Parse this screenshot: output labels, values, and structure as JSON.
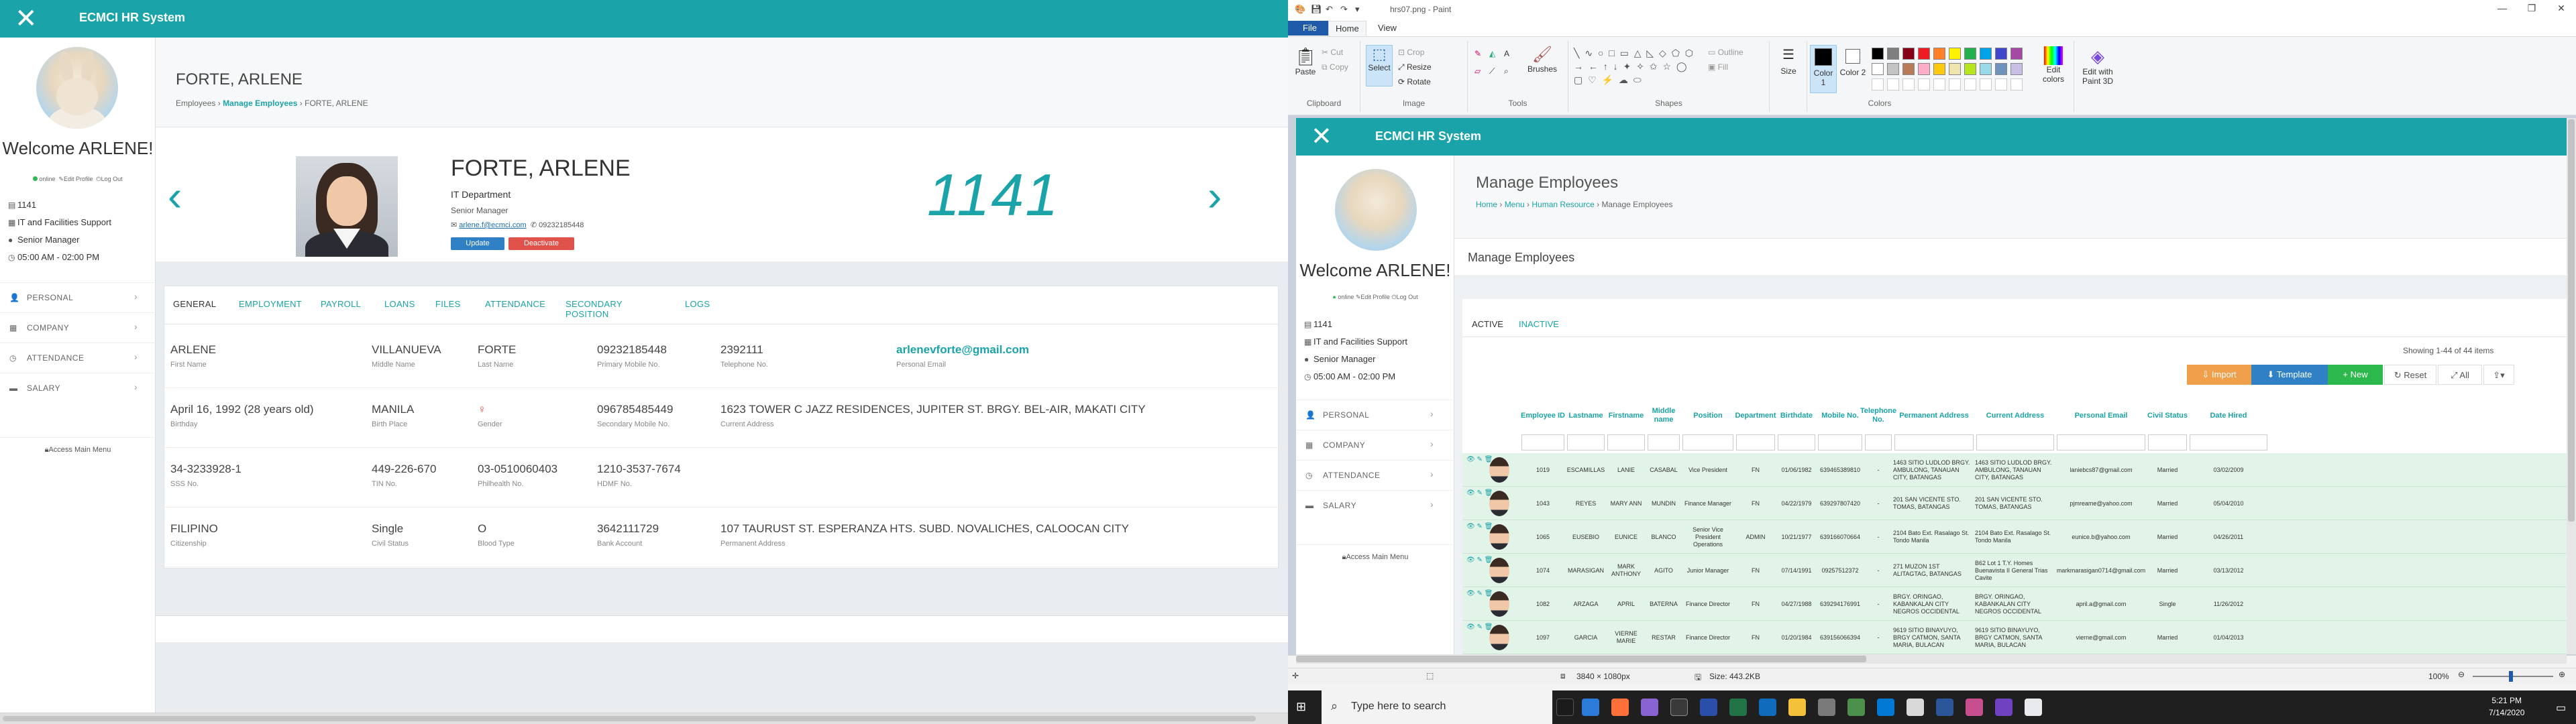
{
  "left": {
    "app_title": "ECMCI HR System",
    "close_symbol": "✕",
    "sidebar": {
      "welcome": "Welcome ARLENE!",
      "status_online": "online",
      "edit_profile": "Edit Profile",
      "logout": "Log Out",
      "emp_id": "1141",
      "department": "IT and Facilities Support",
      "position": "Senior Manager",
      "schedule": "05:00 AM - 02:00 PM",
      "menu": [
        "PERSONAL",
        "COMPANY",
        "ATTENDANCE",
        "SALARY"
      ],
      "access_main_menu": "Access Main Menu"
    },
    "page": {
      "title": "FORTE, ARLENE",
      "breadcrumb": [
        "Employees",
        "Manage Employees",
        "FORTE, ARLENE"
      ],
      "breadcrumb_sep": "›"
    },
    "employee": {
      "name": "FORTE, ARLENE",
      "department": "IT Department",
      "position": "Senior Manager",
      "email": "arlene.f@ecmci.com",
      "phone": "09232185448",
      "update_label": "Update",
      "deactivate_label": "Deactivate",
      "id_number": "1141"
    },
    "tabs": [
      "GENERAL",
      "EMPLOYMENT",
      "PAYROLL",
      "LOANS",
      "FILES",
      "ATTENDANCE",
      "SECONDARY POSITION",
      "LOGS"
    ],
    "active_tab": "GENERAL",
    "rows": [
      [
        {
          "value": "ARLENE",
          "label": "First Name"
        },
        {
          "value": "VILLANUEVA",
          "label": "Middle Name"
        },
        {
          "value": "FORTE",
          "label": "Last Name"
        },
        {
          "value": "09232185448",
          "label": "Primary Mobile No."
        },
        {
          "value": "2392111",
          "label": "Telephone No."
        },
        {
          "value": "arlenevforte@gmail.com",
          "label": "Personal Email"
        }
      ],
      [
        {
          "value": "April 16, 1992 (28 years old)",
          "label": "Birthday"
        },
        {
          "value": "MANILA",
          "label": "Birth Place"
        },
        {
          "value": "♀",
          "label": "Gender"
        },
        {
          "value": "096785485449",
          "label": "Secondary Mobile No."
        },
        {
          "value": "1623 TOWER C JAZZ RESIDENCES, JUPITER ST. BRGY. BEL-AIR, MAKATI CITY",
          "label": "Current Address"
        }
      ],
      [
        {
          "value": "34-3233928-1",
          "label": "SSS No."
        },
        {
          "value": "449-226-670",
          "label": "TIN No."
        },
        {
          "value": "03-0510060403",
          "label": "Philhealth No."
        },
        {
          "value": "1210-3537-7674",
          "label": "HDMF No."
        }
      ],
      [
        {
          "value": "FILIPINO",
          "label": "Citizenship"
        },
        {
          "value": "Single",
          "label": "Civil Status"
        },
        {
          "value": "O",
          "label": "Blood Type"
        },
        {
          "value": "3642111729",
          "label": "Bank Account"
        },
        {
          "value": "107 TAURUST ST. ESPERANZA HTS. SUBD. NOVALICHES, CALOOCAN CITY",
          "label": "Permanent Address"
        }
      ]
    ]
  },
  "paint": {
    "window_title": "hrs07.png - Paint",
    "ribbon_tabs": [
      "File",
      "Home",
      "View"
    ],
    "groups": [
      "Clipboard",
      "Image",
      "Tools",
      "Shapes",
      "Colors"
    ],
    "buttons": {
      "paste": "Paste",
      "cut": "Cut",
      "copy": "Copy",
      "select": "Select",
      "crop": "Crop",
      "resize": "Resize",
      "rotate": "Rotate",
      "brushes": "Brushes",
      "outline": "Outline",
      "fill": "Fill",
      "size": "Size",
      "color1": "Color 1",
      "color2": "Color 2",
      "edit_colors": "Edit colors",
      "edit_paint3d": "Edit with Paint 3D"
    },
    "palette": [
      "#000000",
      "#7f7f7f",
      "#880015",
      "#ed1c24",
      "#ff7f27",
      "#fff200",
      "#22b14c",
      "#00a2e8",
      "#3f48cc",
      "#a349a4",
      "#ffffff",
      "#c3c3c3",
      "#b97a57",
      "#ffaec9",
      "#ffc90e",
      "#efe4b0",
      "#b5e61d",
      "#99d9ea",
      "#7092be",
      "#c8bfe7"
    ],
    "status": {
      "dimensions": "3840 × 1080px",
      "size": "Size: 443.2KB",
      "zoom": "100%"
    }
  },
  "shot": {
    "app_title": "ECMCI HR System",
    "welcome": "Welcome ARLENE!",
    "status_online": "online",
    "edit_profile": "Edit Profile",
    "logout": "Log Out",
    "emp_id": "1141",
    "department": "IT and Facilities Support",
    "position": "Senior Manager",
    "schedule": "05:00 AM - 02:00 PM",
    "menu": [
      "PERSONAL",
      "COMPANY",
      "ATTENDANCE",
      "SALARY"
    ],
    "access_main_menu": "Access Main Menu",
    "page_title": "Manage Employees",
    "breadcrumb": [
      "Home",
      "Menu",
      "Human Resource",
      "Manage Employees"
    ],
    "section_title": "Manage Employees",
    "tabs": [
      "ACTIVE",
      "INACTIVE"
    ],
    "showing": "Showing 1-44 of 44 items",
    "toolbar": {
      "import": "Import",
      "template": "Template",
      "new": "New",
      "reset": "Reset",
      "all": "All"
    },
    "columns": [
      "Employee ID",
      "Lastname",
      "Firstname",
      "Middle name",
      "Position",
      "Department",
      "Birthdate",
      "Mobile No.",
      "Telephone No.",
      "Permanent Address",
      "Current Address",
      "Personal Email",
      "Civil Status",
      "Date Hired"
    ],
    "rows": [
      [
        "1019",
        "ESCAMILLAS",
        "LANIE",
        "CASABAL",
        "Vice President",
        "FN",
        "01/06/1982",
        "639465389810",
        "-",
        "1463 SITIO LUDLOD BRGY. AMBULONG, TANAUAN CITY, BATANGAS",
        "1463 SITIO LUDLOD BRGY. AMBULONG, TANAUAN CITY, BATANGAS",
        "laniebcs87@gmail.com",
        "Married",
        "03/02/2009"
      ],
      [
        "1043",
        "REYES",
        "MARY ANN",
        "MUNDIN",
        "Finance Manager",
        "FN",
        "04/22/1979",
        "639297807420",
        "-",
        "201 SAN VICENTE STO. TOMAS, BATANGAS",
        "201 SAN VICENTE STO. TOMAS, BATANGAS",
        "pjmreame@yahoo.com",
        "Married",
        "05/04/2010"
      ],
      [
        "1065",
        "EUSEBIO",
        "EUNICE",
        "BLANCO",
        "Senior Vice President Operations",
        "ADMIN",
        "10/21/1977",
        "639166070664",
        "-",
        "2104 Bato Ext. Rasalago St. Tondo Manila",
        "2104 Bato Ext. Rasalago St. Tondo Manila",
        "eunice.b@yahoo.com",
        "Married",
        "04/26/2011"
      ],
      [
        "1074",
        "MARASIGAN",
        "MARK ANTHONY",
        "AGITO",
        "Junior Manager",
        "FN",
        "07/14/1991",
        "09257512372",
        "-",
        "271 MUZON 1ST ALITAGTAG, BATANGAS",
        "B62 Lot 1 T.Y. Homes Buenavista II General Trias Cavite",
        "markmarasigan0714@gmail.com",
        "Married",
        "03/13/2012"
      ],
      [
        "1082",
        "ARZAGA",
        "APRIL",
        "BATERNA",
        "Finance Director",
        "FN",
        "04/27/1988",
        "639294176991",
        "-",
        "BRGY. ORINGAO, KABANKALAN CITY NEGROS OCCIDENTAL",
        "BRGY. ORINGAO, KABANKALAN CITY NEGROS OCCIDENTAL",
        "april.a@gmail.com",
        "Single",
        "11/26/2012"
      ],
      [
        "1097",
        "GARCIA",
        "VIERNE MARIE",
        "RESTAR",
        "Finance Director",
        "FN",
        "01/20/1984",
        "639156066394",
        "-",
        "9619 SITIO BINAYUYO, BRGY CATMON, SANTA MARIA, BULACAN",
        "9619 SITIO BINAYUYO, BRGY CATMON, SANTA MARIA, BULACAN",
        "vierne@gmail.com",
        "Married",
        "01/04/2013"
      ]
    ]
  },
  "taskbar": {
    "search_placeholder": "Type here to search",
    "time": "5:21 PM",
    "date": "7/14/2020"
  }
}
